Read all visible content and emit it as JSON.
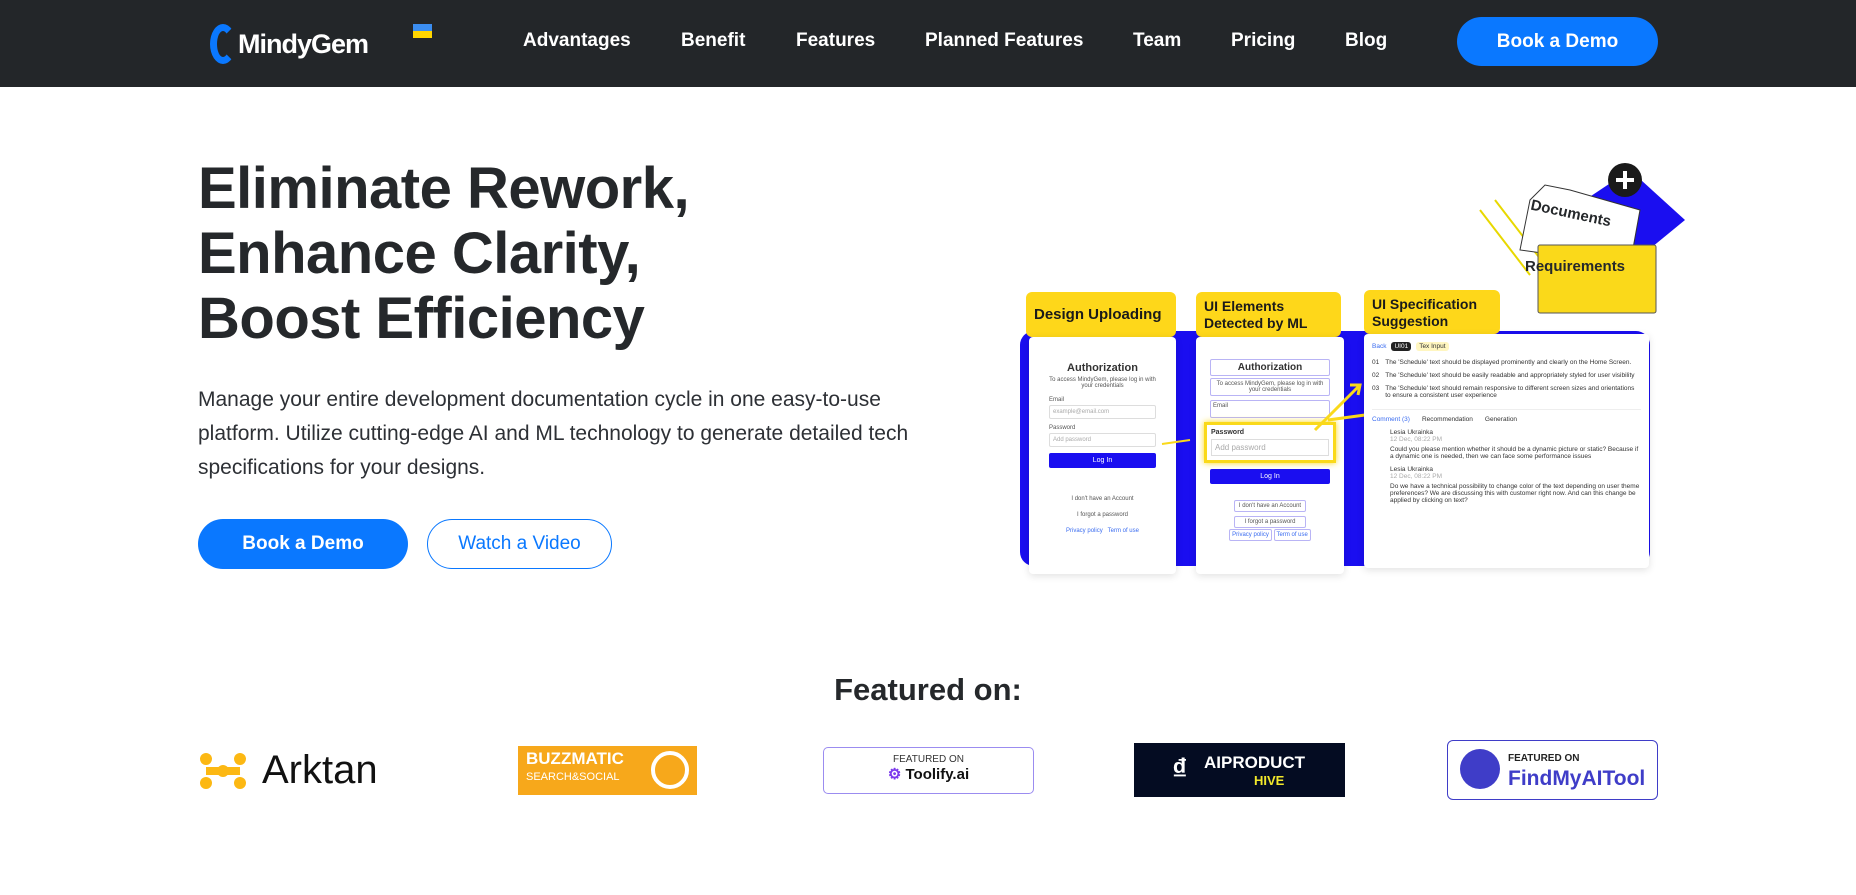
{
  "header": {
    "logo_text": "MindyGem",
    "nav": [
      "Advantages",
      "Benefit",
      "Features",
      "Planned Features",
      "Team",
      "Pricing",
      "Blog"
    ],
    "cta": "Book a Demo",
    "flag_colors": [
      "#3b8df0",
      "#ffd500"
    ]
  },
  "hero": {
    "title_lines": [
      "Eliminate Rework,",
      "Enhance Clarity,",
      "Boost Efficiency"
    ],
    "description": "Manage your entire development documentation cycle in one easy-to-use platform. Utilize cutting-edge AI and ML technology to generate detailed tech specifications for your designs.",
    "primary_button": "Book a Demo",
    "secondary_button": "Watch a Video"
  },
  "illustration": {
    "folder_back": "Documents",
    "folder_front": "Requirements",
    "step1": "Design Uploading",
    "step2": "UI Elements Detected by ML",
    "step3": "UI Specification Suggestion",
    "login": {
      "title": "Authorization",
      "subtitle": "To access MindyGem, please log in with your credentials",
      "email_label": "Email",
      "email_placeholder": "example@email.com",
      "password_label": "Password",
      "password_placeholder": "Add password",
      "login_button": "Log In",
      "no_account": "I don't have an Account",
      "forgot": "I forgot a password",
      "privacy": "Privacy policy",
      "terms": "Term of use"
    },
    "spec": {
      "back": "Back",
      "badge": "UI01",
      "type": "Tex Input",
      "items": [
        {
          "num": "01",
          "text": "The 'Schedule' text should be displayed prominently and clearly on the Home Screen."
        },
        {
          "num": "02",
          "text": "The 'Schedule' text should be easily readable and appropriately styled for user visibility"
        },
        {
          "num": "03",
          "text": "The 'Schedule' text should remain responsive to different screen sizes and orientations to ensure a consistent user experience"
        }
      ],
      "tabs": [
        "Comment (3)",
        "Recommendation",
        "Generation"
      ],
      "comments": [
        {
          "author": "Lesia Ukrainka",
          "time": "12 Dec, 08:22 PM",
          "text": "Could you please mention whether it should be a dynamic picture or static? Because if a dynamic one is needed, then we can face some performance issues"
        },
        {
          "author": "Lesia Ukrainka",
          "time": "12 Dec, 08:22 PM",
          "text": "Do we have a technical possibility to change color of the text depending on user theme preferences? We are discussing this with customer right now. And can this change be applied by clicking on text?"
        }
      ]
    }
  },
  "featured": {
    "heading": "Featured on:",
    "logos": [
      {
        "name": "Arktan"
      },
      {
        "name": "BUZZMATIC",
        "sub": "SEARCH&SOCIAL"
      },
      {
        "pre": "FEATURED ON",
        "name": "Toolify.ai"
      },
      {
        "name": "AIPRODUCT",
        "sub": "HIVE"
      },
      {
        "pre": "FEATURED ON",
        "name": "FindMyAITool"
      }
    ]
  }
}
